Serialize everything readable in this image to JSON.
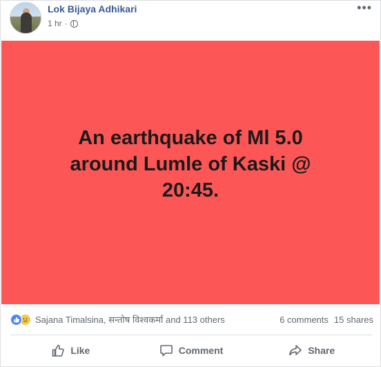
{
  "post": {
    "author": "Lok Bijaya Adhikari",
    "time": "1 hr",
    "separator": "·",
    "more": "•••",
    "content": "An earthquake of Ml 5.0 around Lumle of Kaski @ 20:45.",
    "background_color": "#fd5656"
  },
  "stats": {
    "reactors": "Sajana Timalsina, सन्तोष विश्वकर्मा and 113 others",
    "comments": "6 comments",
    "shares": "15 shares"
  },
  "actions": {
    "like": "Like",
    "comment": "Comment",
    "share": "Share"
  },
  "icons": {
    "privacy": "globe-icon",
    "reactions": [
      "like-reaction-icon",
      "sad-reaction-icon"
    ],
    "actions": [
      "thumbs-up-icon",
      "comment-bubble-icon",
      "share-arrow-icon"
    ]
  },
  "colors": {
    "author_link": "#365899",
    "secondary_text": "#606770",
    "like_blue": "#4a86f7"
  }
}
